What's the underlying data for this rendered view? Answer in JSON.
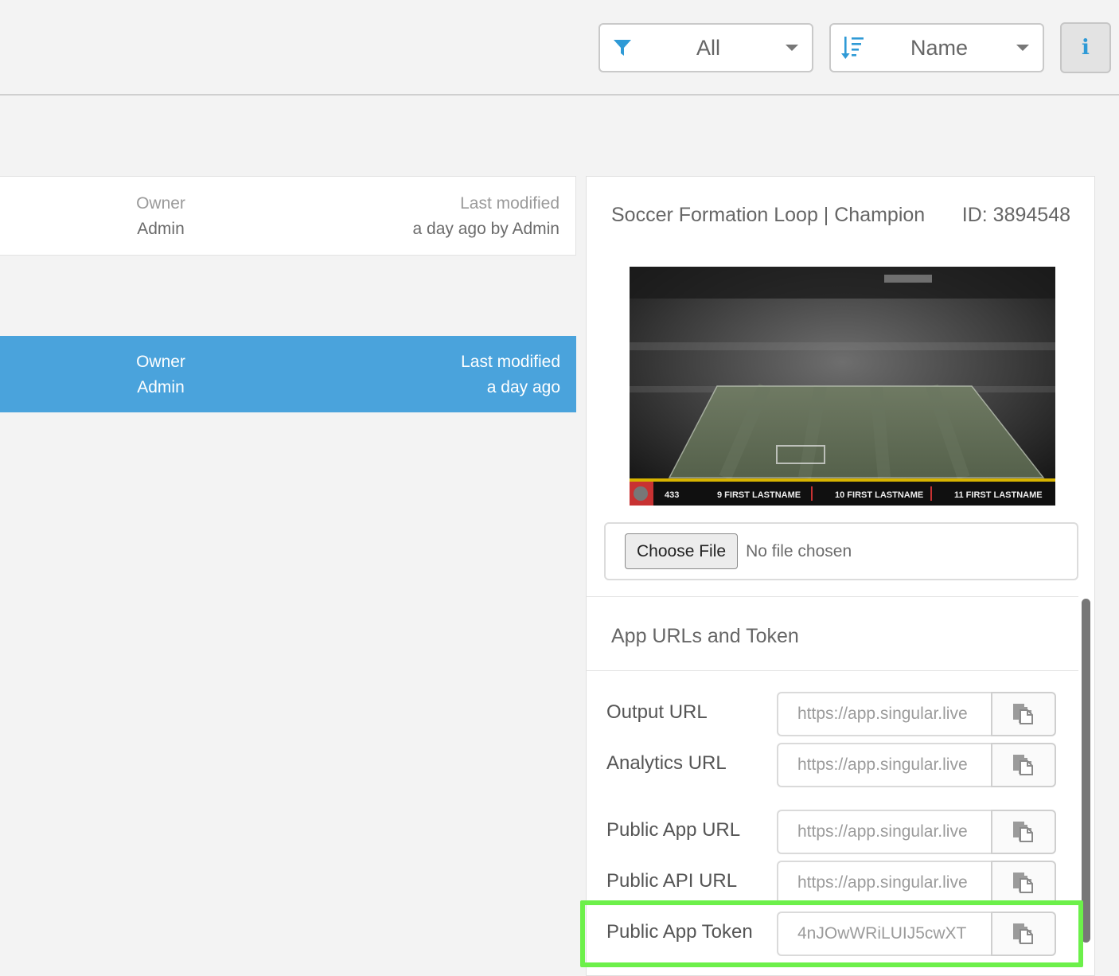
{
  "toolbar": {
    "filter": {
      "label": "All",
      "icon": "filter-icon"
    },
    "sort": {
      "label": "Name",
      "icon": "sort-icon"
    },
    "info": {
      "icon": "info-icon"
    }
  },
  "rows": [
    {
      "owner_label": "Owner",
      "owner": "Admin",
      "modified_label": "Last modified",
      "modified": "a day ago by Admin",
      "selected": false
    },
    {
      "owner_label": "Owner",
      "owner": "Admin",
      "modified_label": "Last modified",
      "modified": "a day ago",
      "selected": true
    }
  ],
  "panel": {
    "title": "Soccer Formation Loop | Champion",
    "id_text": "ID: 3894548",
    "thumbnail": {
      "ticker": [
        "433",
        "9  FIRST LASTNAME",
        "10  FIRST LASTNAME",
        "11  FIRST LASTNAME"
      ]
    },
    "file": {
      "button": "Choose File",
      "status": "No file chosen"
    },
    "section_title": "App URLs and Token",
    "fields": [
      {
        "label": "Output URL",
        "value": "https://app.singular.live"
      },
      {
        "label": "Analytics URL",
        "value": "https://app.singular.live"
      },
      {
        "label": "Public App URL",
        "value": "https://app.singular.live"
      },
      {
        "label": "Public API URL",
        "value": "https://app.singular.live"
      },
      {
        "label": "Public App Token",
        "value": "4nJOwWRiLUIJ5cwXT"
      }
    ]
  },
  "colors": {
    "accent": "#4aa3dc",
    "highlight": "#6cf04a",
    "icon": "#2f9ad6"
  }
}
